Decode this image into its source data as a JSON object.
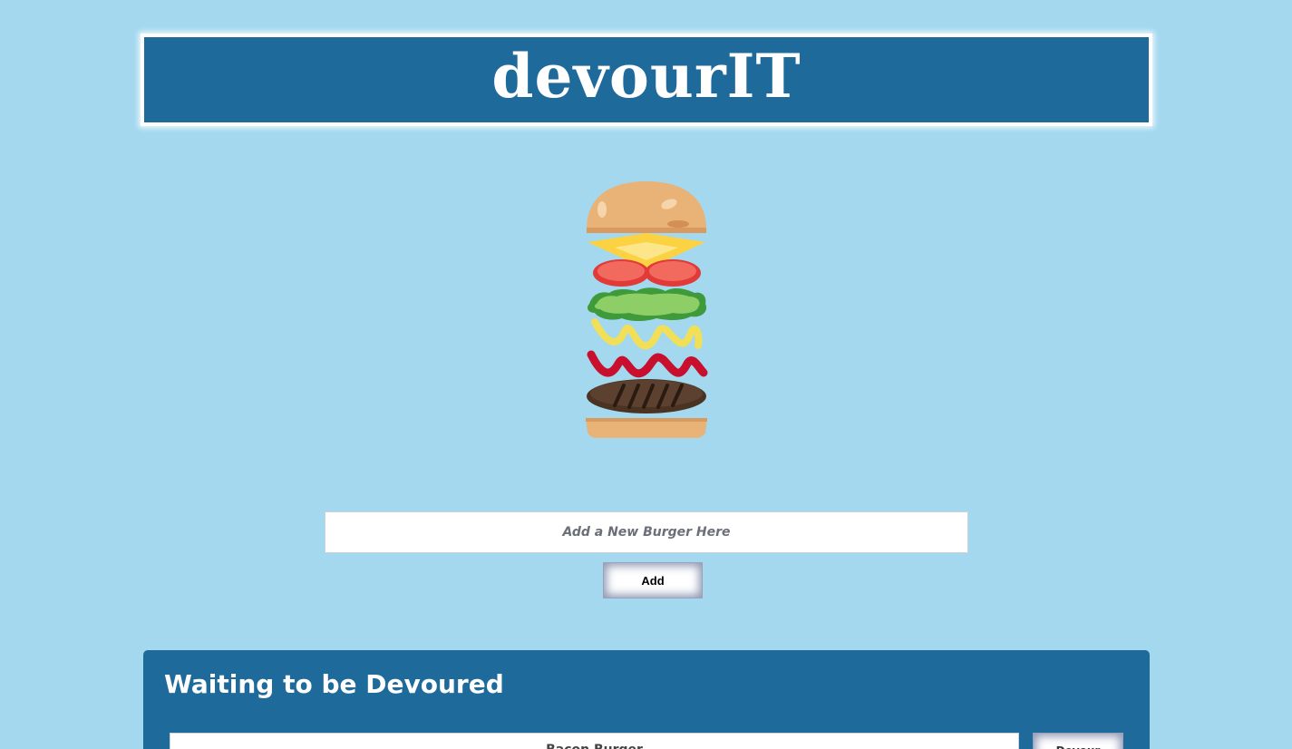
{
  "header": {
    "title": "devourIT"
  },
  "form": {
    "input_placeholder": "Add a New Burger Here",
    "add_label": "Add"
  },
  "waiting": {
    "title": "Waiting to be Devoured",
    "items": [
      {
        "name": "Bacon Burger",
        "button_label": "Devour"
      }
    ]
  },
  "colors": {
    "background": "#a3d8ef",
    "panel": "#1e6a9b",
    "white": "#ffffff"
  }
}
